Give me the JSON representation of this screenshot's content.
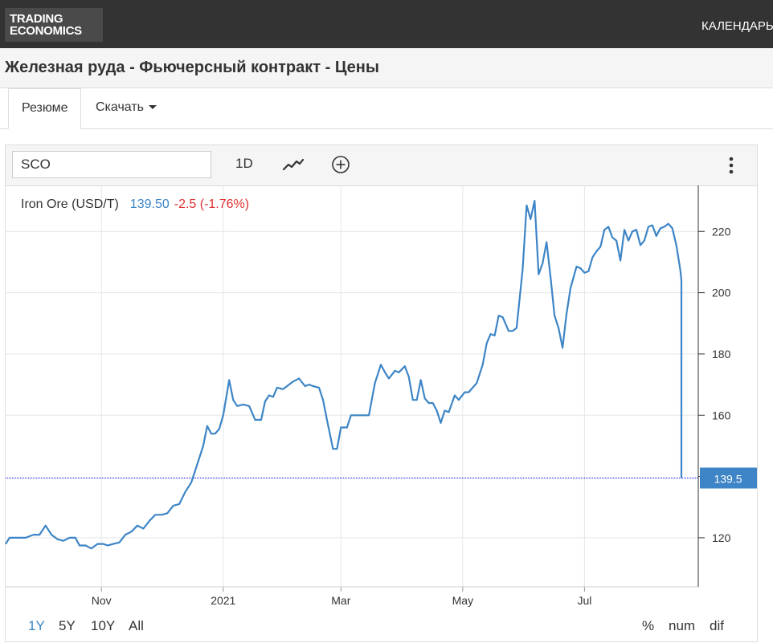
{
  "header": {
    "logo_line1": "TRADING",
    "logo_line2": "ECONOMICS",
    "nav_item": "КАЛЕНДАРЬ"
  },
  "page_title": "Железная руда - Фьючерсный контракт - Цены",
  "tabs": {
    "summary": "Резюме",
    "download": "Скачать"
  },
  "toolbar": {
    "symbol": "SCO",
    "interval": "1D",
    "chart_type_icon": "line-chart-icon",
    "add_icon": "plus-circle-icon",
    "menu_icon": "more-vertical-icon"
  },
  "quote": {
    "name": "Iron Ore (USD/T)",
    "price": "139.50",
    "change": "-2.5 (-1.76%)"
  },
  "ranges": [
    "1Y",
    "5Y",
    "10Y",
    "All"
  ],
  "active_range": "1Y",
  "modes": [
    "%",
    "num",
    "dif"
  ],
  "colors": {
    "line": "#3d85c6",
    "change_negative": "#e03030",
    "last_label_bg": "#3d85c6",
    "last_line": "#0000ff"
  },
  "chart_data": {
    "type": "line",
    "title": "",
    "xlabel": "",
    "ylabel": "",
    "ylim": [
      104,
      235
    ],
    "yticks": [
      120,
      140,
      160,
      180,
      200,
      220
    ],
    "ytick_labels": [
      "120",
      "",
      "160",
      "180",
      "200",
      "220"
    ],
    "x_start": "2020-09-14",
    "x_end": "2021-08-27",
    "xticks": [
      {
        "date": "2020-11-01",
        "label": "Nov"
      },
      {
        "date": "2021-01-01",
        "label": "2021"
      },
      {
        "date": "2021-03-01",
        "label": "Mar"
      },
      {
        "date": "2021-05-01",
        "label": "May"
      },
      {
        "date": "2021-07-01",
        "label": "Jul"
      }
    ],
    "last_value": 139.5,
    "last_value_label": "139.5",
    "grid": true,
    "series": [
      {
        "values": [
          [
            "2020-09-14",
            118
          ],
          [
            "2020-09-16",
            120
          ],
          [
            "2020-09-20",
            120
          ],
          [
            "2020-09-24",
            120
          ],
          [
            "2020-09-28",
            121
          ],
          [
            "2020-10-01",
            121
          ],
          [
            "2020-10-04",
            124
          ],
          [
            "2020-10-07",
            121
          ],
          [
            "2020-10-10",
            119.5
          ],
          [
            "2020-10-13",
            119
          ],
          [
            "2020-10-16",
            120
          ],
          [
            "2020-10-19",
            120
          ],
          [
            "2020-10-21",
            117.5
          ],
          [
            "2020-10-24",
            117.5
          ],
          [
            "2020-10-27",
            116.5
          ],
          [
            "2020-10-30",
            118
          ],
          [
            "2020-11-02",
            118
          ],
          [
            "2020-11-04",
            117.5
          ],
          [
            "2020-11-07",
            118
          ],
          [
            "2020-11-10",
            118.5
          ],
          [
            "2020-11-13",
            121
          ],
          [
            "2020-11-16",
            122
          ],
          [
            "2020-11-19",
            124
          ],
          [
            "2020-11-22",
            123
          ],
          [
            "2020-11-25",
            125.5
          ],
          [
            "2020-11-28",
            127.5
          ],
          [
            "2020-12-01",
            127.5
          ],
          [
            "2020-12-04",
            128
          ],
          [
            "2020-12-07",
            130.5
          ],
          [
            "2020-12-10",
            131
          ],
          [
            "2020-12-13",
            135
          ],
          [
            "2020-12-16",
            138
          ],
          [
            "2020-12-19",
            144
          ],
          [
            "2020-12-22",
            150
          ],
          [
            "2020-12-24",
            156.5
          ],
          [
            "2020-12-26",
            154
          ],
          [
            "2020-12-28",
            154
          ],
          [
            "2020-12-30",
            155.5
          ],
          [
            "2021-01-01",
            160
          ],
          [
            "2021-01-04",
            171.5
          ],
          [
            "2021-01-06",
            165
          ],
          [
            "2021-01-08",
            163
          ],
          [
            "2021-01-11",
            163.5
          ],
          [
            "2021-01-14",
            163
          ],
          [
            "2021-01-17",
            158.5
          ],
          [
            "2021-01-20",
            158.5
          ],
          [
            "2021-01-22",
            164.5
          ],
          [
            "2021-01-24",
            166.5
          ],
          [
            "2021-01-26",
            166
          ],
          [
            "2021-01-28",
            169
          ],
          [
            "2021-01-31",
            168.5
          ],
          [
            "2021-02-02",
            169.5
          ],
          [
            "2021-02-05",
            171
          ],
          [
            "2021-02-08",
            172
          ],
          [
            "2021-02-11",
            169.5
          ],
          [
            "2021-02-13",
            170
          ],
          [
            "2021-02-15",
            169.5
          ],
          [
            "2021-02-18",
            169
          ],
          [
            "2021-02-20",
            165
          ],
          [
            "2021-02-22",
            158.5
          ],
          [
            "2021-02-25",
            149
          ],
          [
            "2021-02-27",
            149
          ],
          [
            "2021-03-01",
            156
          ],
          [
            "2021-03-04",
            156
          ],
          [
            "2021-03-06",
            160
          ],
          [
            "2021-03-09",
            160
          ],
          [
            "2021-03-12",
            160
          ],
          [
            "2021-03-15",
            160
          ],
          [
            "2021-03-18",
            170.5
          ],
          [
            "2021-03-21",
            176.5
          ],
          [
            "2021-03-23",
            174
          ],
          [
            "2021-03-25",
            172
          ],
          [
            "2021-03-28",
            174.5
          ],
          [
            "2021-03-30",
            174
          ],
          [
            "2021-04-02",
            176
          ],
          [
            "2021-04-04",
            172.5
          ],
          [
            "2021-04-06",
            165
          ],
          [
            "2021-04-08",
            165
          ],
          [
            "2021-04-10",
            171.5
          ],
          [
            "2021-04-12",
            165.5
          ],
          [
            "2021-04-14",
            164
          ],
          [
            "2021-04-16",
            164
          ],
          [
            "2021-04-18",
            161.5
          ],
          [
            "2021-04-20",
            157.5
          ],
          [
            "2021-04-22",
            161.5
          ],
          [
            "2021-04-24",
            161
          ],
          [
            "2021-04-27",
            166.5
          ],
          [
            "2021-04-29",
            165
          ],
          [
            "2021-05-02",
            167.5
          ],
          [
            "2021-05-04",
            167.5
          ],
          [
            "2021-05-06",
            169
          ],
          [
            "2021-05-08",
            170.5
          ],
          [
            "2021-05-11",
            176.5
          ],
          [
            "2021-05-13",
            183.5
          ],
          [
            "2021-05-15",
            186.5
          ],
          [
            "2021-05-17",
            186
          ],
          [
            "2021-05-19",
            192.5
          ],
          [
            "2021-05-21",
            192
          ],
          [
            "2021-05-24",
            187.5
          ],
          [
            "2021-05-26",
            187.5
          ],
          [
            "2021-05-28",
            188.5
          ],
          [
            "2021-05-31",
            207.5
          ],
          [
            "2021-06-02",
            228.5
          ],
          [
            "2021-06-04",
            224
          ],
          [
            "2021-06-06",
            230
          ],
          [
            "2021-06-08",
            206
          ],
          [
            "2021-06-10",
            209.5
          ],
          [
            "2021-06-12",
            216.5
          ],
          [
            "2021-06-14",
            205
          ],
          [
            "2021-06-16",
            192.5
          ],
          [
            "2021-06-18",
            188.5
          ],
          [
            "2021-06-20",
            182
          ],
          [
            "2021-06-22",
            193
          ],
          [
            "2021-06-24",
            201.5
          ],
          [
            "2021-06-27",
            208.5
          ],
          [
            "2021-06-29",
            208
          ],
          [
            "2021-07-01",
            206.5
          ],
          [
            "2021-07-03",
            207
          ],
          [
            "2021-07-05",
            211.5
          ],
          [
            "2021-07-07",
            213.5
          ],
          [
            "2021-07-09",
            215
          ],
          [
            "2021-07-11",
            220.5
          ],
          [
            "2021-07-13",
            221.5
          ],
          [
            "2021-07-15",
            218
          ],
          [
            "2021-07-17",
            217
          ],
          [
            "2021-07-19",
            210.5
          ],
          [
            "2021-07-21",
            220.5
          ],
          [
            "2021-07-23",
            217
          ],
          [
            "2021-07-25",
            220
          ],
          [
            "2021-07-27",
            220.5
          ],
          [
            "2021-07-29",
            215.5
          ],
          [
            "2021-07-31",
            217
          ],
          [
            "2021-08-02",
            221.5
          ],
          [
            "2021-08-04",
            222
          ],
          [
            "2021-08-06",
            218.5
          ],
          [
            "2021-08-08",
            221
          ],
          [
            "2021-08-10",
            221.5
          ],
          [
            "2021-08-12",
            222.5
          ],
          [
            "2021-08-14",
            221
          ],
          [
            "2021-08-16",
            215.5
          ],
          [
            "2021-08-18",
            207.5
          ],
          [
            "2021-08-20",
            204
          ],
          [
            "2021-08-22",
            200.5
          ],
          [
            "2021-08-24",
            193
          ],
          [
            "2021-08-26",
            191
          ],
          [
            "2021-08-28",
            188
          ],
          [
            "2021-08-30",
            180
          ],
          [
            "2021-09-01",
            170
          ],
          [
            "2021-09-03",
            166.5
          ],
          [
            "2021-09-05",
            163.5
          ],
          [
            "2021-09-07",
            161
          ],
          [
            "2021-09-09",
            161
          ],
          [
            "2021-09-11",
            157.5
          ],
          [
            "2021-09-13",
            142
          ],
          [
            "2021-09-15",
            139.5
          ]
        ]
      }
    ]
  }
}
